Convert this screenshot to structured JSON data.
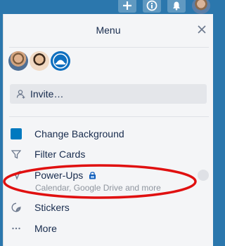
{
  "topbar": {
    "add_icon": "plus-icon",
    "info_icon": "info-icon",
    "notifications_icon": "bell-icon"
  },
  "menu": {
    "title": "Menu",
    "close_icon": "close-icon"
  },
  "members": [
    "member-avatar-1",
    "member-avatar-2",
    "member-avatar-3"
  ],
  "invite": {
    "label": "Invite…",
    "icon": "person-add-icon"
  },
  "items": [
    {
      "label": "Change Background",
      "icon": "color-swatch-icon",
      "color": "#0079bf"
    },
    {
      "label": "Filter Cards",
      "icon": "filter-icon"
    },
    {
      "label": "Power-Ups",
      "icon": "rocket-icon",
      "subtext": "Calendar, Google Drive and more",
      "badge_icon": "lock-icon"
    },
    {
      "label": "Stickers",
      "icon": "sticker-icon"
    },
    {
      "label": "More",
      "icon": "ellipsis-icon"
    }
  ],
  "annotation": {
    "color": "#e01010",
    "shape": "ellipse"
  },
  "colors": {
    "header_blue": "#2b77ad",
    "panel_bg": "#f4f5f7",
    "text": "#172b4d",
    "muted": "#8f959e"
  }
}
